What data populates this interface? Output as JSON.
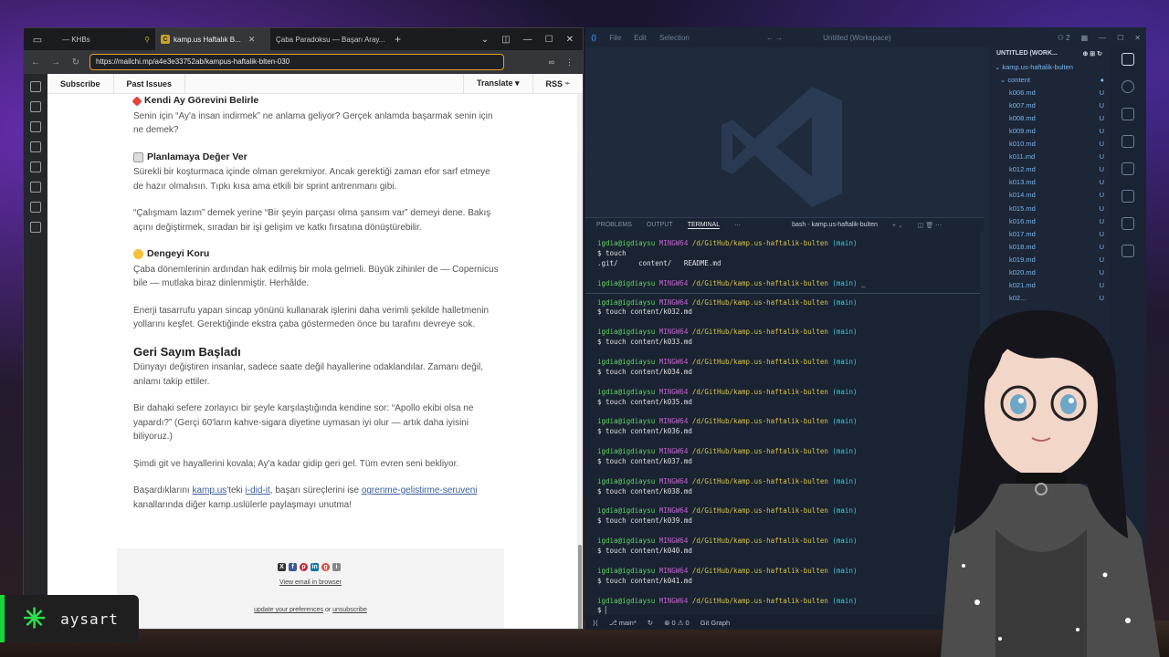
{
  "browser": {
    "tabs": [
      {
        "label": "— KHBs"
      },
      {
        "label": "kamp.us Haftalık B..."
      },
      {
        "label": "Çaba Paradoksu — Başarı Aray..."
      }
    ],
    "url": "https://mailchi.mp/a4e3e33752ab/kampus-haftalik-blten-030",
    "nav_left": [
      "Subscribe",
      "Past Issues"
    ],
    "nav_right": [
      "Translate ▾",
      "RSS"
    ]
  },
  "article": {
    "s1_title": "Kendi Ay Görevini Belirle",
    "s1_p1": "Senin için “Ay'a insan indirmek” ne anlama geliyor? Gerçek anlamda başarmak senin için ne demek?",
    "s2_title": "Planlamaya Değer Ver",
    "s2_p1": "Sürekli bir koşturmaca içinde olman gerekmiyor. Ancak gerektiği zaman efor sarf etmeye de hazır olmalısın. Tıpkı kısa ama etkili bir sprint antrenmanı gibi.",
    "s2_p2": "“Çalışmam lazım” demek yerine “Bir şeyin parçası olma şansım var” demeyi dene. Bakış açını değiştirmek, sıradan bir işi gelişim ve katkı fırsatına dönüştürebilir.",
    "s3_title": "Dengeyi Koru",
    "s3_p1": "Çaba dönemlerinin ardından hak edilmiş bir mola gelmeli. Büyük zihinler de — Copernicus bile — mutlaka biraz dinlenmiştir. Herhâlde.",
    "s3_p2": "Enerji tasarrufu yapan sincap yönünü kullanarak işlerini daha verimli şekilde halletmenin yollarını keşfet. Gerektiğinde ekstra çaba göstermeden önce bu tarafını devreye sok.",
    "h_countdown": "Geri Sayım Başladı",
    "c_p1": "Dünyayı değiştiren insanlar, sadece saate değil hayallerine odaklandılar. Zamanı değil, anlamı takip ettiler.",
    "c_p2": "Bir dahaki sefere zorlayıcı bir şeyle karşılaştığında kendine sor: “Apollo ekibi olsa ne yapardı?” (Gerçi 60'ların kahve-sigara diyetine uymasan iyi olur — artık daha iyisini biliyoruz.)",
    "c_p3": "Şimdi git ve hayallerini kovala; Ay'a kadar gidip geri gel. Tüm evren seni bekliyor.",
    "c_p4_a": "Başardıklarını ",
    "c_p4_link1": "kamp.us",
    "c_p4_b": "'teki ",
    "c_p4_link2": "i-did-it",
    "c_p4_c": ", başarı süreçlerini ise ",
    "c_p4_link3": "ogrenme-gelistirme-seruveni",
    "c_p4_d": " kanallarında diğer kamp.uslülerle paylaşmayı unutma!"
  },
  "footer": {
    "view_in_browser": "View email in browser",
    "update_prefs": "update your preferences",
    "or": " or ",
    "unsubscribe": "unsubscribe"
  },
  "vscode": {
    "menu": [
      "File",
      "Edit",
      "Selection"
    ],
    "search": "Untitled (Workspace)",
    "panel_tabs": [
      "PROBLEMS",
      "OUTPUT",
      "TERMINAL"
    ],
    "shell_label": "bash - kamp.us-haftalik-bulten",
    "prompt_user": "igdia@igdiaysu",
    "prompt_host": "MINGW64",
    "prompt_path": "/d/GitHub/kamp.us-haftalik-bulten",
    "prompt_branch": "(main)",
    "first_cmd": "$ touch",
    "first_out": ".git/     content/   README.md",
    "commands": [
      "$ touch content/k032.md",
      "$ touch content/k033.md",
      "$ touch content/k034.md",
      "$ touch content/k035.md",
      "$ touch content/k036.md",
      "$ touch content/k037.md",
      "$ touch content/k038.md",
      "$ touch content/k039.md",
      "$ touch content/k040.md",
      "$ touch content/k041.md"
    ],
    "explorer_title": "UNTITLED (WORK...",
    "explorer_root": "kamp.us-haftalik-bulten",
    "explorer_folder": "content",
    "files": [
      "k006.md",
      "k007.md",
      "k008.md",
      "k009.md",
      "k010.md",
      "k011.md",
      "k012.md",
      "k013.md",
      "k014.md",
      "k015.md",
      "k016.md",
      "k017.md",
      "k018.md",
      "k019.md",
      "k020.md",
      "k021.md",
      "k02..."
    ],
    "file_status": "U",
    "status_branch": "main*",
    "status_problems": "⊗ 0  ⚠ 0",
    "status_git": "Git Graph"
  },
  "overlay": {
    "name": "aysart"
  }
}
